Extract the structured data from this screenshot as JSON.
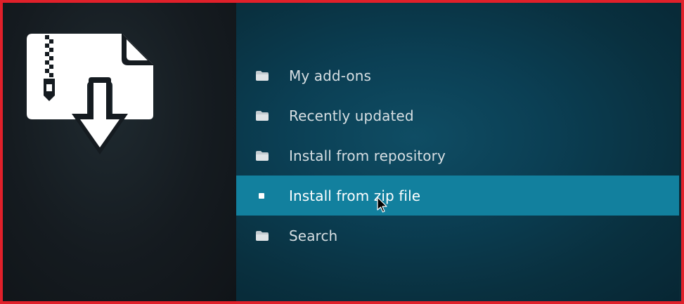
{
  "menu": {
    "items": [
      {
        "label": "My add-ons",
        "icon": "folder-icon",
        "focused": false
      },
      {
        "label": "Recently updated",
        "icon": "folder-icon",
        "focused": false
      },
      {
        "label": "Install from repository",
        "icon": "folder-icon",
        "focused": false
      },
      {
        "label": "Install from zip file",
        "icon": "bullet-icon",
        "focused": true
      },
      {
        "label": "Search",
        "icon": "folder-icon",
        "focused": false
      }
    ]
  },
  "colors": {
    "frame_border": "#e0202a",
    "focus_highlight": "#12809e",
    "left_panel": "#151b20",
    "right_panel": "#0b3f54"
  },
  "artwork": {
    "icon": "zip-file-install-icon"
  }
}
